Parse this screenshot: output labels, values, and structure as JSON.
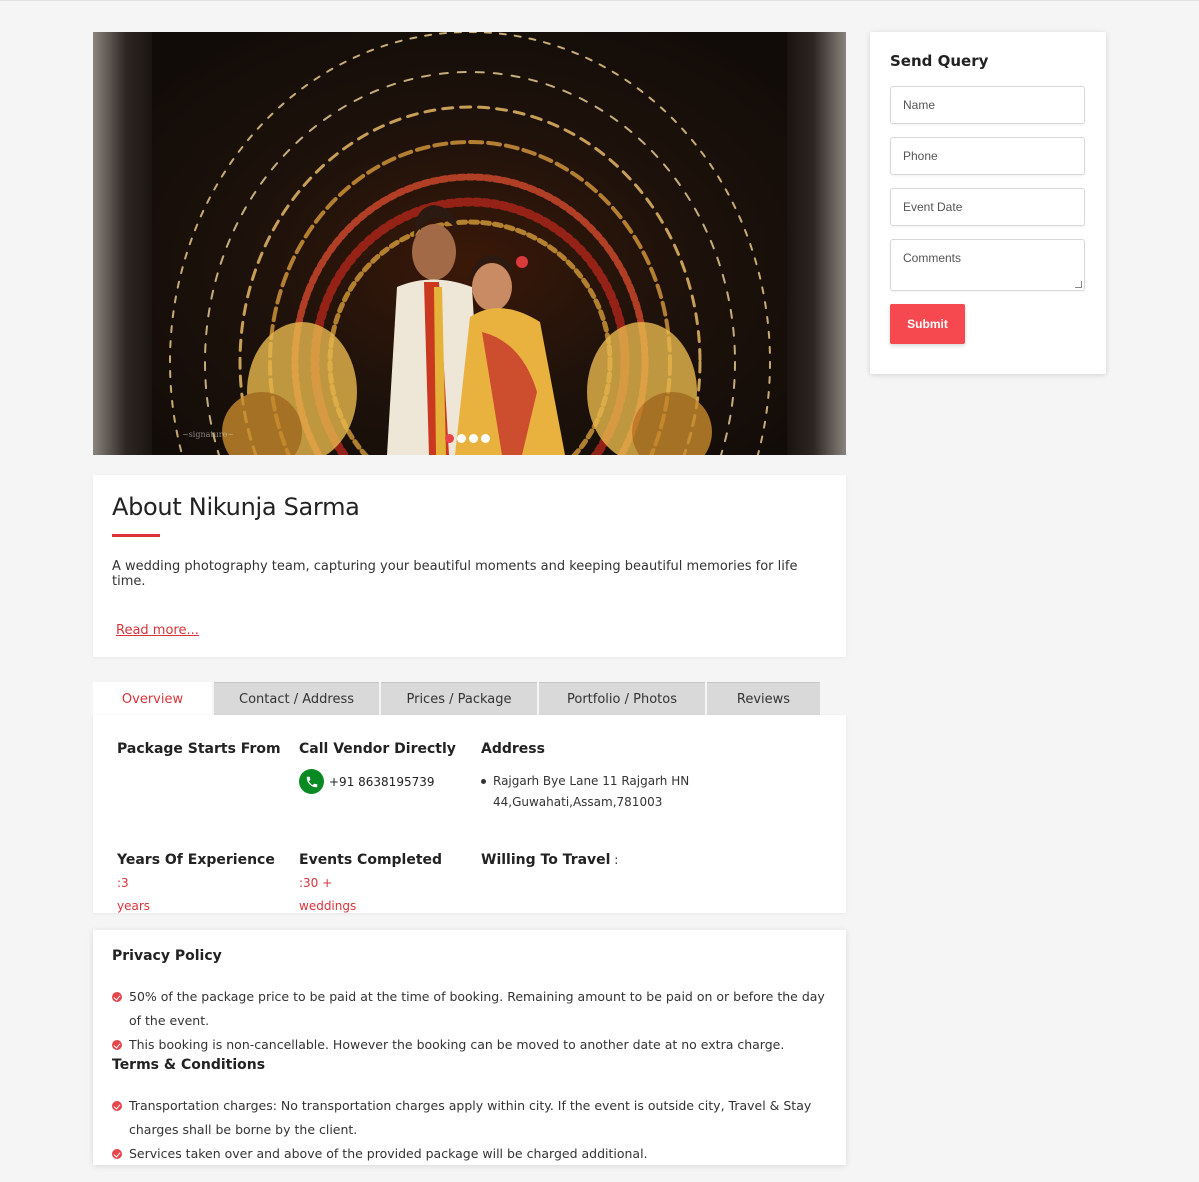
{
  "carousel": {
    "slides_total": 4,
    "active_slide": 1
  },
  "query": {
    "title": "Send Query",
    "name_placeholder": "Name",
    "phone_placeholder": "Phone",
    "event_date_placeholder": "Event Date",
    "comments_placeholder": "Comments",
    "submit_label": "Submit"
  },
  "about": {
    "title": "About Nikunja Sarma",
    "description": "A wedding photography team, capturing your beautiful moments and keeping beautiful memories for life time.",
    "read_more": "Read more..."
  },
  "tabs": [
    {
      "label": "Overview",
      "active": true
    },
    {
      "label": "Contact / Address",
      "active": false
    },
    {
      "label": "Prices / Package",
      "active": false
    },
    {
      "label": "Portfolio / Photos",
      "active": false
    },
    {
      "label": "Reviews",
      "active": false
    }
  ],
  "overview": {
    "package_label": "Package Starts From",
    "call_label": "Call Vendor Directly",
    "phone": "+91 8638195739",
    "address_label": "Address",
    "address_line1": "Rajgarh Bye Lane 11 Rajgarh HN",
    "address_line2": "44,Guwahati,Assam,781003",
    "experience_label": "Years Of Experience",
    "experience_sep": " :",
    "experience_value_a": "3",
    "experience_value_b": "years",
    "events_label": "Events Completed",
    "events_sep": " :",
    "events_value_a": "30 +",
    "events_value_b": "weddings",
    "travel_label": "Willing To Travel",
    "travel_sep": " :"
  },
  "privacy": {
    "title": "Privacy Policy",
    "items": [
      "50% of the package price to be paid at the time of booking. Remaining amount to be paid on or before the day of the event.",
      "This booking is non-cancellable. However the booking can be moved to another date at no extra charge."
    ]
  },
  "terms": {
    "title": "Terms & Conditions",
    "items": [
      "Transportation charges: No transportation charges apply within city. If the event is outside city, Travel & Stay charges shall be borne by the client.",
      "Services taken over and above of the provided package will be charged additional."
    ]
  },
  "colors": {
    "accent": "#d9343b",
    "submit": "#f5484f",
    "phone_icon": "#0a8a22"
  }
}
